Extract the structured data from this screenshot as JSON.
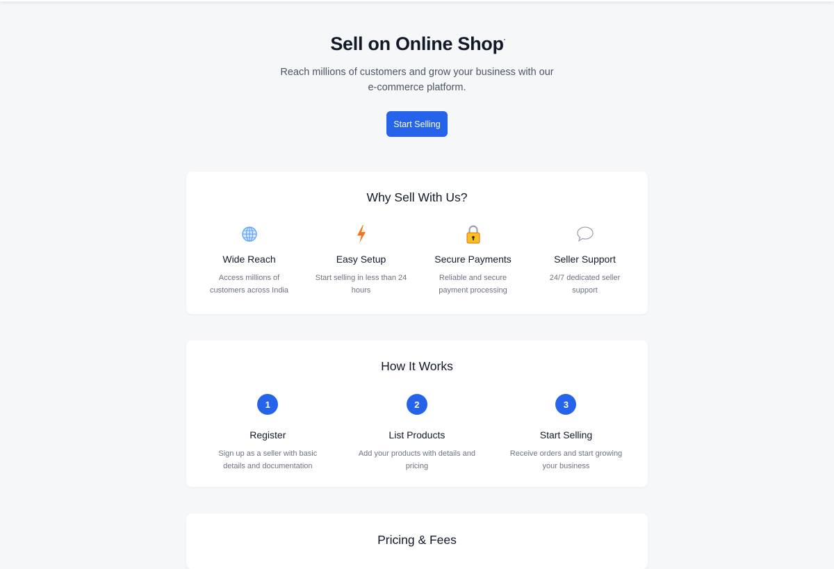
{
  "hero": {
    "title": "Sell on Online Shop",
    "subtitle": "Reach millions of customers and grow your business with our e-commerce platform.",
    "cta_label": "Start Selling"
  },
  "why": {
    "title": "Why Sell With Us?",
    "features": [
      {
        "icon": "globe-icon",
        "name": "Wide Reach",
        "desc": "Access millions of customers across India"
      },
      {
        "icon": "lightning-icon",
        "name": "Easy Setup",
        "desc": "Start selling in less than 24 hours"
      },
      {
        "icon": "lock-icon",
        "name": "Secure Payments",
        "desc": "Reliable and secure payment processing"
      },
      {
        "icon": "chat-bubble-icon",
        "name": "Seller Support",
        "desc": "24/7 dedicated seller support"
      }
    ]
  },
  "how": {
    "title": "How It Works",
    "steps": [
      {
        "num": "1",
        "name": "Register",
        "desc": "Sign up as a seller with basic details and documentation"
      },
      {
        "num": "2",
        "name": "List Products",
        "desc": "Add your products with details and pricing"
      },
      {
        "num": "3",
        "name": "Start Selling",
        "desc": "Receive orders and start growing your business"
      }
    ]
  },
  "pricing": {
    "title": "Pricing & Fees"
  },
  "colors": {
    "accent": "#2563eb",
    "page_bg": "#f6f7f9",
    "card_bg": "#ffffff",
    "muted_text": "#6b7280"
  }
}
